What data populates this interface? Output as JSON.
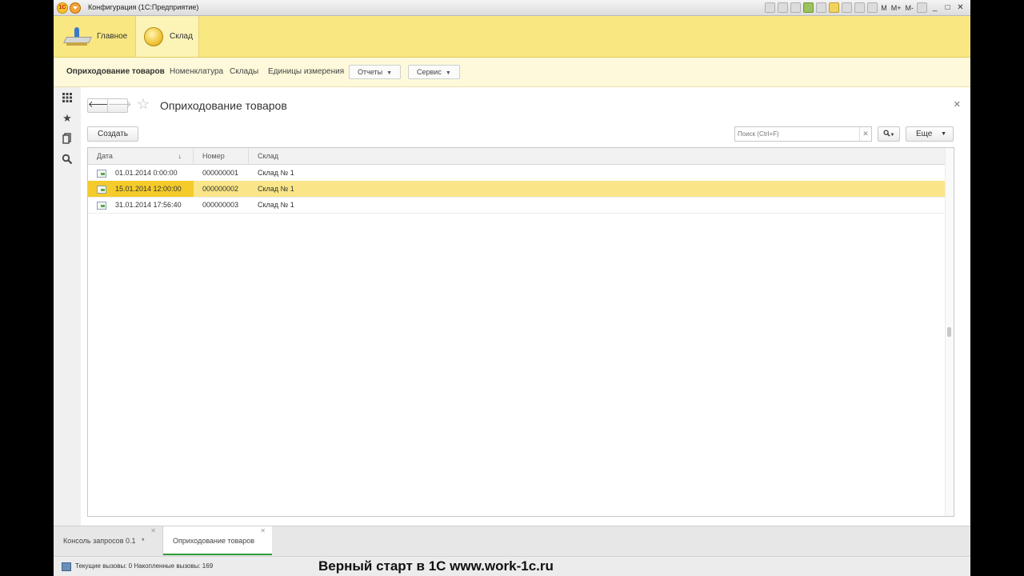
{
  "window": {
    "title": "Конфигурация  (1С:Предприятие)",
    "logo_text": "1С",
    "tools": [
      "M",
      "M+",
      "M-"
    ]
  },
  "sections": [
    {
      "label": "Главное",
      "icon": "desk-lamp-icon"
    },
    {
      "label": "Склад",
      "icon": "coin-icon"
    }
  ],
  "functions": {
    "receipt": "Оприходование товаров",
    "nomenclature": "Номенклатура",
    "warehouses": "Склады",
    "units": "Единицы измерения",
    "reports": "Отчеты",
    "service": "Сервис"
  },
  "form": {
    "title": "Оприходование товаров",
    "create_button": "Создать",
    "search_placeholder": "Поиск (Ctrl+F)",
    "more_button": "Еще"
  },
  "table": {
    "columns": [
      "Дата",
      "Номер",
      "Склад"
    ],
    "sort_indicator": "↓",
    "rows": [
      {
        "date": "01.01.2014 0:00:00",
        "number": "000000001",
        "warehouse": "Склад № 1"
      },
      {
        "date": "15.01.2014 12:00:00",
        "number": "000000002",
        "warehouse": "Склад № 1"
      },
      {
        "date": "31.01.2014 17:56:40",
        "number": "000000003",
        "warehouse": "Склад № 1"
      }
    ],
    "selected_row": 2
  },
  "open_windows": [
    {
      "label": "Консоль запросов 0.1",
      "modified_mark": "*"
    },
    {
      "label": "Оприходование товаров"
    }
  ],
  "status": {
    "calls": "Текущие вызовы: 0   Накопленные вызовы: 169"
  },
  "watermark": "Верный старт в 1С www.work-1c.ru"
}
